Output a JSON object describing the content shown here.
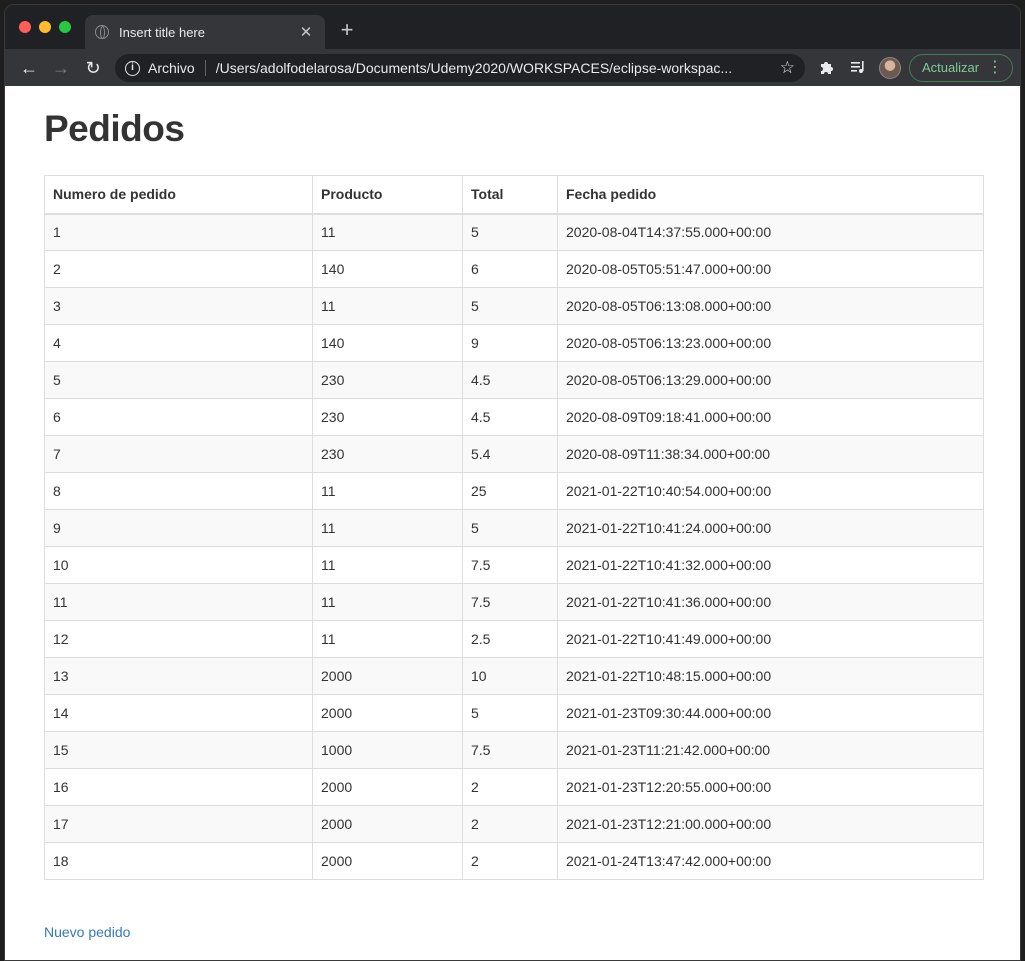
{
  "browser": {
    "tab_title": "Insert title here",
    "tab_close": "✕",
    "new_tab": "+",
    "scheme_label": "Archivo",
    "url": "/Users/adolfodelarosa/Documents/Udemy2020/WORKSPACES/eclipse-workspac...",
    "update_label": "Actualizar"
  },
  "page": {
    "title": "Pedidos",
    "table": {
      "headers": [
        "Numero de pedido",
        "Producto",
        "Total",
        "Fecha pedido"
      ],
      "rows": [
        [
          "1",
          "11",
          "5",
          "2020-08-04T14:37:55.000+00:00"
        ],
        [
          "2",
          "140",
          "6",
          "2020-08-05T05:51:47.000+00:00"
        ],
        [
          "3",
          "11",
          "5",
          "2020-08-05T06:13:08.000+00:00"
        ],
        [
          "4",
          "140",
          "9",
          "2020-08-05T06:13:23.000+00:00"
        ],
        [
          "5",
          "230",
          "4.5",
          "2020-08-05T06:13:29.000+00:00"
        ],
        [
          "6",
          "230",
          "4.5",
          "2020-08-09T09:18:41.000+00:00"
        ],
        [
          "7",
          "230",
          "5.4",
          "2020-08-09T11:38:34.000+00:00"
        ],
        [
          "8",
          "11",
          "25",
          "2021-01-22T10:40:54.000+00:00"
        ],
        [
          "9",
          "11",
          "5",
          "2021-01-22T10:41:24.000+00:00"
        ],
        [
          "10",
          "11",
          "7.5",
          "2021-01-22T10:41:32.000+00:00"
        ],
        [
          "11",
          "11",
          "7.5",
          "2021-01-22T10:41:36.000+00:00"
        ],
        [
          "12",
          "11",
          "2.5",
          "2021-01-22T10:41:49.000+00:00"
        ],
        [
          "13",
          "2000",
          "10",
          "2021-01-22T10:48:15.000+00:00"
        ],
        [
          "14",
          "2000",
          "5",
          "2021-01-23T09:30:44.000+00:00"
        ],
        [
          "15",
          "1000",
          "7.5",
          "2021-01-23T11:21:42.000+00:00"
        ],
        [
          "16",
          "2000",
          "2",
          "2021-01-23T12:20:55.000+00:00"
        ],
        [
          "17",
          "2000",
          "2",
          "2021-01-23T12:21:00.000+00:00"
        ],
        [
          "18",
          "2000",
          "2",
          "2021-01-24T13:47:42.000+00:00"
        ]
      ]
    },
    "new_order_link": "Nuevo pedido"
  },
  "colors": {
    "link": "#337ab7",
    "update_accent": "#81c995",
    "row_stripe": "#f9f9f9"
  }
}
